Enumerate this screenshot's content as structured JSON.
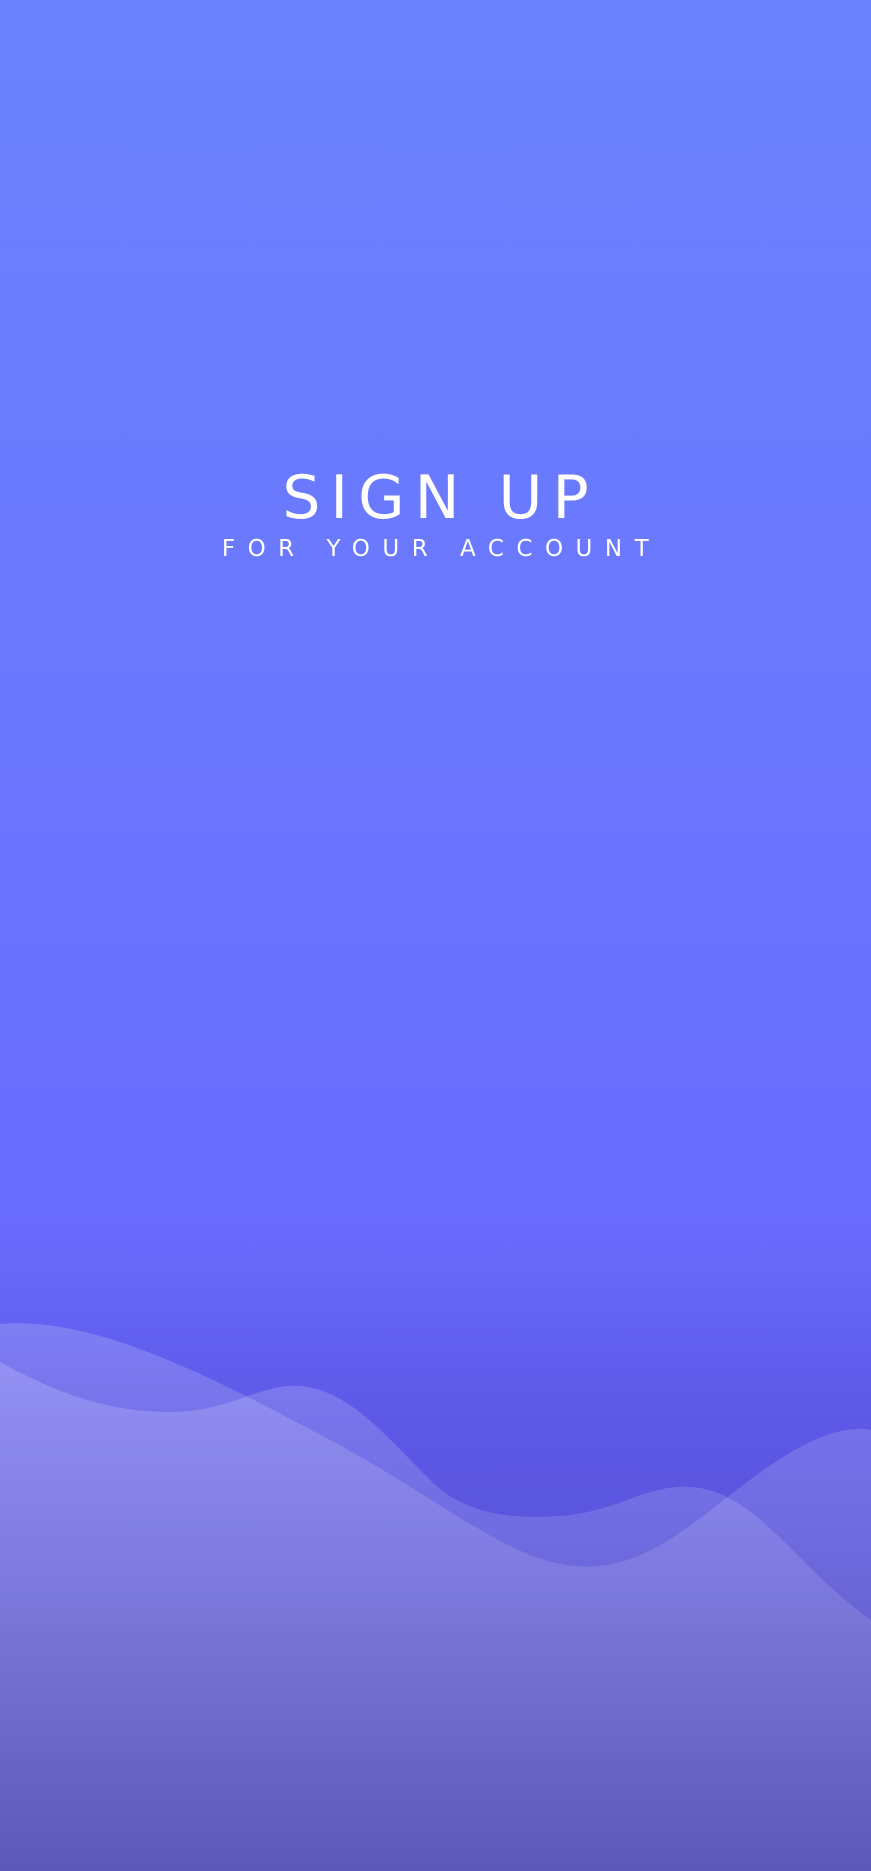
{
  "screen": {
    "title": "SIGN UP",
    "subtitle": "FOR YOUR ACCOUNT"
  },
  "colors": {
    "background_top": "#6b82fd",
    "background_mid": "#6a6cfe",
    "background_bottom": "#4e4ab2",
    "text": "#ffffff"
  }
}
